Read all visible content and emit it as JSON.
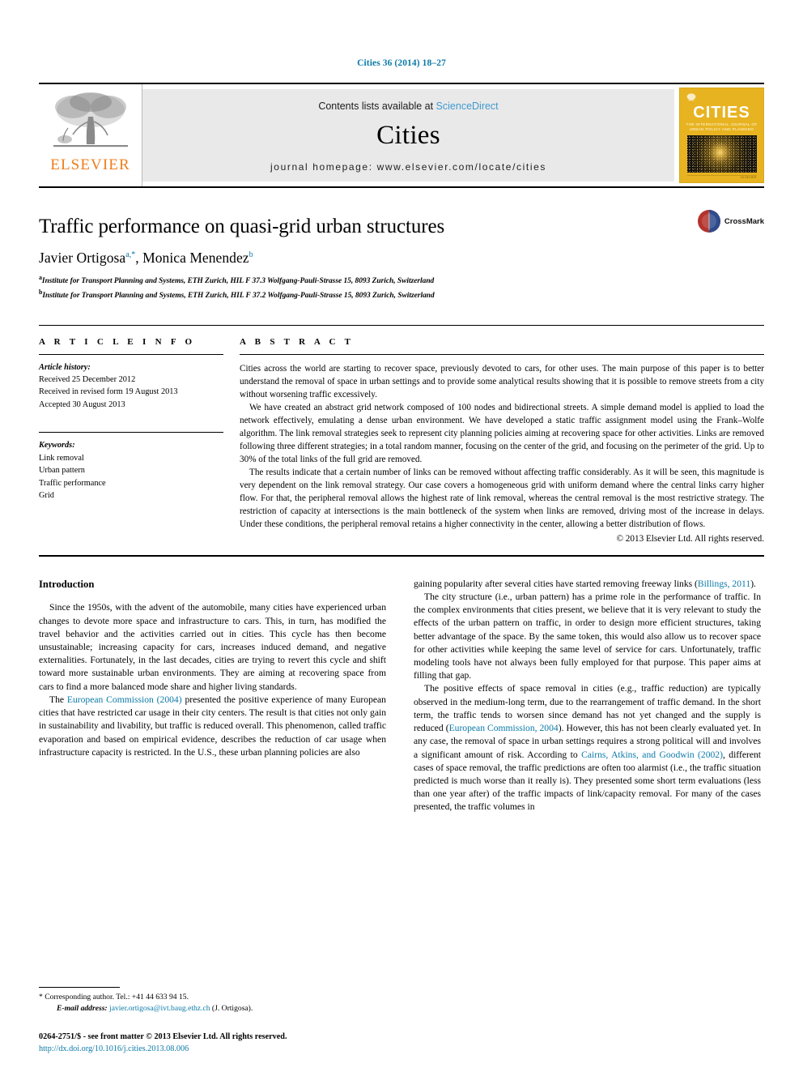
{
  "running_head": "Cities 36 (2014) 18–27",
  "masthead": {
    "publisher_name": "ELSEVIER",
    "contents_prefix": "Contents lists available at ",
    "contents_link": "ScienceDirect",
    "journal_title": "Cities",
    "homepage": "journal homepage: www.elsevier.com/locate/cities",
    "cover": {
      "title": "CITIES",
      "subtitle": "THE INTERNATIONAL JOURNAL OF URBAN POLICY AND PLANNING",
      "footer_note": "ELSEVIER"
    }
  },
  "article": {
    "title": "Traffic performance on quasi-grid urban structures",
    "authors": "Javier Ortigosa, Monica Menendez",
    "author_1": "Javier Ortigosa",
    "author_1_marks": "a,*",
    "author_2": "Monica Menendez",
    "author_2_marks": "b",
    "affiliation_a_mark": "a",
    "affiliation_a": "Institute for Transport Planning and Systems, ETH Zurich, HIL F 37.3 Wolfgang-Pauli-Strasse 15, 8093 Zurich, Switzerland",
    "affiliation_b_mark": "b",
    "affiliation_b": "Institute for Transport Planning and Systems, ETH Zurich, HIL F 37.2 Wolfgang-Pauli-Strasse 15, 8093 Zurich, Switzerland",
    "crossmark_label": "CrossMark"
  },
  "article_info": {
    "heading": "A R T I C L E   I N F O",
    "history_label": "Article history:",
    "history": [
      "Received 25 December 2012",
      "Received in revised form 19 August 2013",
      "Accepted 30 August 2013"
    ],
    "keywords_label": "Keywords:",
    "keywords": [
      "Link removal",
      "Urban pattern",
      "Traffic performance",
      "Grid"
    ]
  },
  "abstract": {
    "heading": "A B S T R A C T",
    "paragraphs": [
      "Cities across the world are starting to recover space, previously devoted to cars, for other uses. The main purpose of this paper is to better understand the removal of space in urban settings and to provide some analytical results showing that it is possible to remove streets from a city without worsening traffic excessively.",
      "We have created an abstract grid network composed of 100 nodes and bidirectional streets. A simple demand model is applied to load the network effectively, emulating a dense urban environment. We have developed a static traffic assignment model using the Frank–Wolfe algorithm. The link removal strategies seek to represent city planning policies aiming at recovering space for other activities. Links are removed following three different strategies; in a total random manner, focusing on the center of the grid, and focusing on the perimeter of the grid. Up to 30% of the total links of the full grid are removed.",
      "The results indicate that a certain number of links can be removed without affecting traffic considerably. As it will be seen, this magnitude is very dependent on the link removal strategy. Our case covers a homogeneous grid with uniform demand where the central links carry higher flow. For that, the peripheral removal allows the highest rate of link removal, whereas the central removal is the most restrictive strategy. The restriction of capacity at intersections is the main bottleneck of the system when links are removed, driving most of the increase in delays. Under these conditions, the peripheral removal retains a higher connectivity in the center, allowing a better distribution of flows."
    ],
    "copyright": "© 2013 Elsevier Ltd. All rights reserved."
  },
  "body": {
    "section_heading": "Introduction",
    "left_p1": "Since the 1950s, with the advent of the automobile, many cities have experienced urban changes to devote more space and infrastructure to cars. This, in turn, has modified the travel behavior and the activities carried out in cities. This cycle has then become unsustainable; increasing capacity for cars, increases induced demand, and negative externalities. Fortunately, in the last decades, cities are trying to revert this cycle and shift toward more sustainable urban environments. They are aiming at recovering space from cars to find a more balanced mode share and higher living standards.",
    "left_p2_before": "The ",
    "left_p2_link": "European Commission (2004)",
    "left_p2_after": " presented the positive experience of many European cities that have restricted car usage in their city centers. The result is that cities not only gain in sustainability and livability, but traffic is reduced overall. This phenomenon, called traffic evaporation and based on empirical evidence, describes the reduction of car usage when infrastructure capacity is restricted. In the U.S., these urban planning policies are also",
    "right_p0_before": "gaining popularity after several cities have started removing freeway links (",
    "right_p0_link": "Billings, 2011",
    "right_p0_after": ").",
    "right_p1": "The city structure (i.e., urban pattern) has a prime role in the performance of traffic. In the complex environments that cities present, we believe that it is very relevant to study the effects of the urban pattern on traffic, in order to design more efficient structures, taking better advantage of the space. By the same token, this would also allow us to recover space for other activities while keeping the same level of service for cars. Unfortunately, traffic modeling tools have not always been fully employed for that purpose. This paper aims at filling that gap.",
    "right_p2_a": "The positive effects of space removal in cities (e.g., traffic reduction) are typically observed in the medium-long term, due to the rearrangement of traffic demand. In the short term, the traffic tends to worsen since demand has not yet changed and the supply is reduced (",
    "right_p2_link1": "European Commission, 2004",
    "right_p2_b": "). However, this has not been clearly evaluated yet. In any case, the removal of space in urban settings requires a strong political will and involves a significant amount of risk. According to ",
    "right_p2_link2": "Cairns, Atkins, and Goodwin (2002)",
    "right_p2_c": ", different cases of space removal, the traffic predictions are often too alarmist (i.e., the traffic situation predicted is much worse than it really is). They presented some short term evaluations (less than one year after) of the traffic impacts of link/capacity removal. For many of the cases presented, the traffic volumes in"
  },
  "footnotes": {
    "corresponding_mark": "*",
    "corresponding": "Corresponding author. Tel.: +41 44 633 94 15.",
    "email_label": "E-mail address:",
    "email": "javier.ortigosa@ivt.baug.ethz.ch",
    "email_owner": "(J. Ortigosa).",
    "issn_line": "0264-2751/$ - see front matter © 2013 Elsevier Ltd. All rights reserved.",
    "doi": "http://dx.doi.org/10.1016/j.cities.2013.08.006"
  },
  "colors": {
    "link": "#0b7aa8",
    "elsevier_orange": "#f07c1a",
    "cover_yellow": "#e8b321",
    "masthead_gray": "#e9e9e9"
  }
}
